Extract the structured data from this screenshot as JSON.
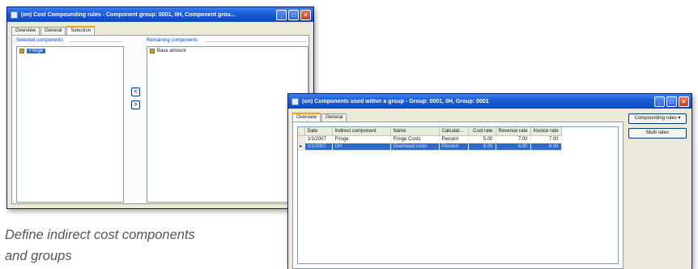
{
  "window1": {
    "title": "(on) Cost Compounding rules - Component group: 0001, 0H, Component grou...",
    "tabs": [
      "Overview",
      "General",
      "Selection"
    ],
    "selected_label": "Selected components",
    "remaining_label": "Remaining components",
    "selected_items": [
      "Fringe"
    ],
    "remaining_items": [
      "Base amount"
    ],
    "add_symbol": "<",
    "remove_symbol": ">"
  },
  "window2": {
    "title": "(on) Components used within a group - Group: 0001, 0H, Group: 0001",
    "tabs": [
      "Overview",
      "General"
    ],
    "columns": [
      "Date",
      "Indirect component",
      "Name",
      "Calculat...",
      "Cost rate",
      "Revenue rate",
      "Invoice rate"
    ],
    "rows": [
      {
        "indicator": "",
        "date": "1/1/2007",
        "component": "Fringe",
        "name": "Fringe Costs",
        "calc": "Percent",
        "cost": "5.00",
        "revenue": "7.00",
        "invoice": "7.00"
      },
      {
        "indicator": "▸",
        "date": "1/1/2007",
        "component": "OH",
        "name": "Overhead costs",
        "calc": "Percent",
        "cost": "6.00",
        "revenue": "6.00",
        "invoice": "6.00"
      }
    ],
    "buttons": {
      "compounding": "Compounding rules ▾",
      "multi": "Multi rates"
    }
  },
  "caption": {
    "line1": "Define indirect cost components",
    "line2": "and groups"
  },
  "colors": {
    "titlebar": "#1c5bd6",
    "selection": "#316ac5",
    "window_bg": "#ece9d8"
  }
}
